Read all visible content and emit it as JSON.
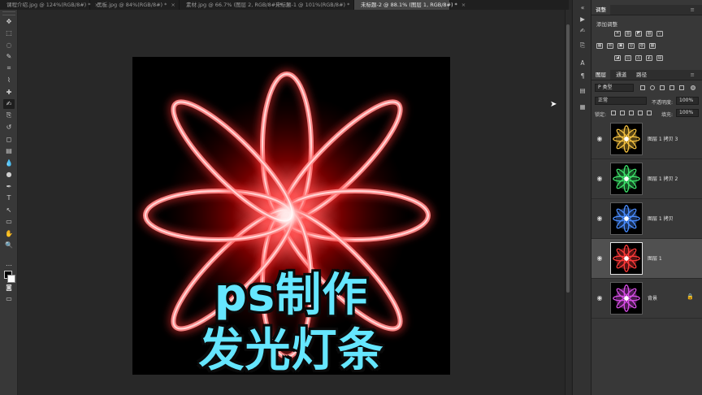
{
  "tabs": [
    {
      "label": "课程介绍.jpg @ 124%(RGB/8#)",
      "active": false
    },
    {
      "label": "黑板.jpg @ 84%(RGB/8#)",
      "active": false
    },
    {
      "label": "素材.jpg @ 66.7% (图层 2, RGB/8#)",
      "active": false
    },
    {
      "label": "未标题-1 @ 101%(RGB/8#)",
      "active": false
    },
    {
      "label": "未标题-2 @ 88.1% (图层 1, RGB/8#)",
      "active": true
    }
  ],
  "tab_close_glyph": "×",
  "tab_modified_mark": "*",
  "toolbar": {
    "icons": [
      "move-icon",
      "marquee-icon",
      "lasso-icon",
      "quick-select-icon",
      "crop-icon",
      "eyedropper-icon",
      "healing-icon",
      "brush-icon",
      "stamp-icon",
      "history-brush-icon",
      "eraser-icon",
      "gradient-icon",
      "blur-icon",
      "dodge-icon",
      "pen-icon",
      "type-icon",
      "path-select-icon",
      "shape-icon",
      "hand-icon",
      "zoom-icon",
      "more-icon",
      "color-swatch",
      "quick-mask-icon",
      "screen-mode-icon"
    ],
    "glyphs": [
      "✥",
      "⬚",
      "◌",
      "✎",
      "⌗",
      "⌇",
      "✚",
      "✍",
      "⎘",
      "↺",
      "◻",
      "▤",
      "💧",
      "●",
      "✒",
      "T",
      "↖",
      "▭",
      "✋",
      "🔍",
      "…",
      "",
      "◙",
      "▭"
    ],
    "selected_index": 7
  },
  "document": {
    "caption_line1": "ps制作",
    "caption_line2": "发光灯条",
    "glow_color": "#ff2a2a",
    "caption_color": "#65e6ff"
  },
  "adjustments": {
    "tab_label": "调整",
    "add_label": "添加调整",
    "icons_row1": [
      "☀",
      "▥",
      "◩",
      "▧",
      "▽"
    ],
    "icons_row2": [
      "▦",
      "⚖",
      "▣",
      "◎",
      "◍",
      "▦"
    ],
    "icons_row3": [
      "◪",
      "◫",
      "◬",
      "◭",
      "▤"
    ]
  },
  "layers_panel": {
    "tabs": [
      "图层",
      "通道",
      "路径"
    ],
    "filter_label": "P 类型",
    "blend_mode": "正常",
    "opacity_label": "不透明度:",
    "opacity_value": "100%",
    "lock_label": "锁定:",
    "fill_label": "填充:",
    "fill_value": "100%",
    "layers": [
      {
        "name": "图层 1 拷贝 3",
        "color": "#f3c040",
        "selected": false,
        "locked": false
      },
      {
        "name": "图层 1 拷贝 2",
        "color": "#3ee36b",
        "selected": false,
        "locked": false
      },
      {
        "name": "图层 1 拷贝",
        "color": "#4a8dff",
        "selected": false,
        "locked": false
      },
      {
        "name": "图层 1",
        "color": "#ff3a3a",
        "selected": true,
        "locked": false
      },
      {
        "name": "背景",
        "color": "#d94ee8",
        "selected": false,
        "locked": true
      }
    ],
    "eye_glyph": "◉",
    "lock_glyph": "🔒"
  },
  "strip_icons": [
    "play-icon",
    "brush-settings-icon",
    "clone-source-icon",
    "character-icon",
    "paragraph-icon",
    "properties-icon",
    "libraries-icon"
  ]
}
